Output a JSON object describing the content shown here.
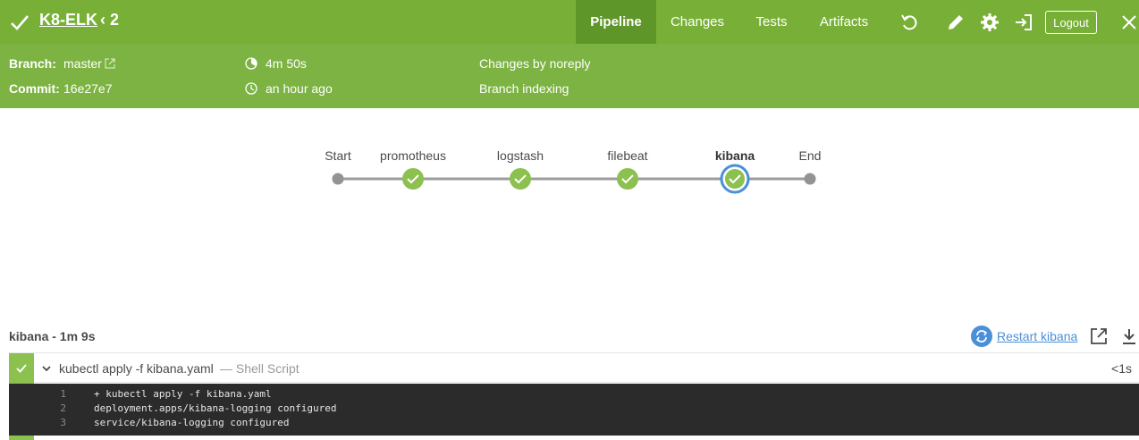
{
  "header": {
    "title": "K8-ELK",
    "run_number": "2",
    "nav": [
      {
        "label": "Pipeline",
        "active": true
      },
      {
        "label": "Changes",
        "active": false
      },
      {
        "label": "Tests",
        "active": false
      },
      {
        "label": "Artifacts",
        "active": false
      }
    ],
    "logout_label": "Logout",
    "accent_color": "#78b037"
  },
  "info": {
    "branch_label": "Branch:",
    "branch_value": "master",
    "commit_label": "Commit:",
    "commit_value": "16e27e7",
    "duration": "4m 50s",
    "started": "an hour ago",
    "changes": "Changes by noreply",
    "cause": "Branch indexing"
  },
  "pipeline": {
    "stages": [
      {
        "name": "Start",
        "status": "start"
      },
      {
        "name": "promotheus",
        "status": "success"
      },
      {
        "name": "logstash",
        "status": "success"
      },
      {
        "name": "filebeat",
        "status": "success"
      },
      {
        "name": "kibana",
        "status": "success",
        "selected": true
      },
      {
        "name": "End",
        "status": "end"
      }
    ]
  },
  "log": {
    "title": "kibana - 1m 9s",
    "restart_label": "Restart kibana",
    "step": {
      "command": "kubectl apply -f kibana.yaml",
      "type": "— Shell Script",
      "duration": "<1s"
    },
    "lines": [
      {
        "num": "1",
        "text": "+ kubectl apply -f kibana.yaml"
      },
      {
        "num": "2",
        "text": "deployment.apps/kibana-logging configured"
      },
      {
        "num": "3",
        "text": "service/kibana-logging configured"
      }
    ]
  }
}
